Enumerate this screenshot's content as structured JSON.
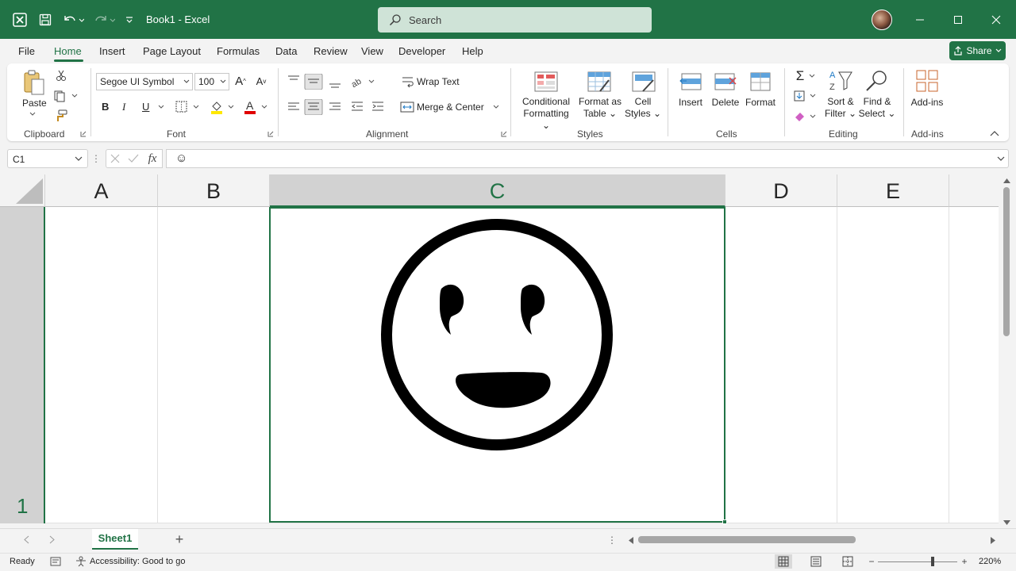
{
  "titlebar": {
    "doc_title": "Book1  -  Excel",
    "search_placeholder": "Search"
  },
  "tabs": [
    "File",
    "Home",
    "Insert",
    "Page Layout",
    "Formulas",
    "Data",
    "Review",
    "View",
    "Developer",
    "Help"
  ],
  "share_label": "Share",
  "ribbon": {
    "clipboard": {
      "paste": "Paste",
      "label": "Clipboard"
    },
    "font": {
      "family": "Segoe UI Symbol",
      "size": "100",
      "bold": "B",
      "italic": "I",
      "underline": "U",
      "label": "Font"
    },
    "alignment": {
      "wrap": "Wrap Text",
      "merge": "Merge & Center",
      "label": "Alignment"
    },
    "styles": {
      "cond1": "Conditional",
      "cond2": "Formatting",
      "fmt1": "Format as",
      "fmt2": "Table",
      "cell1": "Cell",
      "cell2": "Styles",
      "label": "Styles"
    },
    "cells": {
      "insert": "Insert",
      "delete": "Delete",
      "format": "Format",
      "label": "Cells"
    },
    "editing": {
      "sort1": "Sort &",
      "sort2": "Filter",
      "find1": "Find &",
      "find2": "Select",
      "label": "Editing"
    },
    "addins": {
      "btn": "Add-ins",
      "label": "Add-ins"
    }
  },
  "formula": {
    "namebox": "C1",
    "content": "☺"
  },
  "grid": {
    "columns": [
      "A",
      "B",
      "C",
      "D",
      "E"
    ],
    "row": "1",
    "selected_col": "C"
  },
  "sheets": {
    "active": "Sheet1"
  },
  "status": {
    "ready": "Ready",
    "accessibility": "Accessibility: Good to go",
    "zoom": "220%"
  },
  "colors": {
    "brand": "#217346"
  },
  "icons": [
    "excel-logo-icon",
    "save-icon",
    "undo-icon",
    "redo-icon",
    "search-icon",
    "paste-icon",
    "cut-icon",
    "copy-icon",
    "format-painter-icon",
    "smiley-emoji-icon"
  ]
}
